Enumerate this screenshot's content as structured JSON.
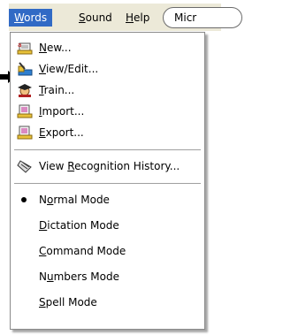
{
  "menubar": {
    "items": [
      {
        "pre": "",
        "key": "W",
        "post": "ords"
      },
      {
        "pre": "",
        "key": "S",
        "post": "ound"
      },
      {
        "pre": "",
        "key": "H",
        "post": "elp"
      }
    ],
    "mic_label": "Micr"
  },
  "menu": {
    "items": [
      {
        "pre": "",
        "key": "N",
        "post": "ew...",
        "icon": "new-icon"
      },
      {
        "pre": "",
        "key": "V",
        "post": "iew/Edit...",
        "icon": "view-edit-icon"
      },
      {
        "pre": "",
        "key": "T",
        "post": "rain...",
        "icon": "train-icon"
      },
      {
        "pre": "",
        "key": "I",
        "post": "mport...",
        "icon": "import-icon"
      },
      {
        "pre": "",
        "key": "E",
        "post": "xport...",
        "icon": "export-icon"
      },
      {
        "pre": "View ",
        "key": "R",
        "post": "ecognition History...",
        "icon": "recognition-history-icon"
      }
    ],
    "modes": [
      {
        "pre": "N",
        "key": "o",
        "post": "rmal Mode",
        "selected": true
      },
      {
        "pre": "",
        "key": "D",
        "post": "ictation Mode",
        "selected": false
      },
      {
        "pre": "",
        "key": "C",
        "post": "ommand Mode",
        "selected": false
      },
      {
        "pre": "N",
        "key": "u",
        "post": "mbers Mode",
        "selected": false
      },
      {
        "pre": "",
        "key": "S",
        "post": "pell Mode",
        "selected": false
      }
    ]
  },
  "colors": {
    "menu_highlight": "#316ac5",
    "menubar_bg": "#ece9d8"
  }
}
